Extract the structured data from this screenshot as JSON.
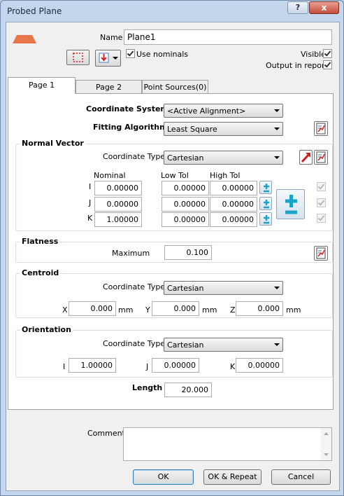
{
  "window": {
    "title": "Probed Plane",
    "help_label": "?",
    "close_label": "x"
  },
  "header": {
    "name_label": "Name",
    "name_value": "Plane1",
    "use_nominals_label": "Use nominals",
    "use_nominals_checked": true,
    "visible_label": "Visible",
    "visible_checked": true,
    "output_label": "Output in report",
    "output_checked": true
  },
  "tabs": [
    {
      "label": "Page 1",
      "active": true
    },
    {
      "label": "Page 2",
      "active": false
    },
    {
      "label": "Point Sources(0)",
      "active": false
    }
  ],
  "page1": {
    "coordinate_system_label": "Coordinate System",
    "coordinate_system_value": "<Active Alignment>",
    "fitting_algorithm_label": "Fitting Algorithm",
    "fitting_algorithm_value": "Least Square",
    "normal_vector": {
      "title": "Normal Vector",
      "coord_type_label": "Coordinate Type",
      "coord_type_value": "Cartesian",
      "col_nominal": "Nominal",
      "col_low_tol": "Low Tol",
      "col_high_tol": "High Tol",
      "rows": [
        {
          "axis": "I",
          "nominal": "0.00000",
          "low": "0.00000",
          "high": "0.00000",
          "checked": true
        },
        {
          "axis": "J",
          "nominal": "0.00000",
          "low": "0.00000",
          "high": "0.00000",
          "checked": true
        },
        {
          "axis": "K",
          "nominal": "1.00000",
          "low": "0.00000",
          "high": "0.00000",
          "checked": true
        }
      ]
    },
    "flatness": {
      "title": "Flatness",
      "maximum_label": "Maximum",
      "maximum_value": "0.100"
    },
    "centroid": {
      "title": "Centroid",
      "coord_type_label": "Coordinate Type",
      "coord_type_value": "Cartesian",
      "x_label": "X",
      "x_value": "0.000",
      "y_label": "Y",
      "y_value": "0.000",
      "z_label": "Z",
      "z_value": "0.000",
      "unit": "mm"
    },
    "orientation": {
      "title": "Orientation",
      "coord_type_label": "Coordinate Type",
      "coord_type_value": "Cartesian",
      "i_label": "I",
      "i_value": "1.00000",
      "j_label": "J",
      "j_value": "0.00000",
      "k_label": "K",
      "k_value": "0.00000"
    },
    "length_label": "Length",
    "length_value": "20.000"
  },
  "footer": {
    "comment_label": "Comment",
    "comment_value": "",
    "ok_label": "OK",
    "ok_repeat_label": "OK & Repeat",
    "cancel_label": "Cancel"
  },
  "colors": {
    "plane_icon": "#e8764a",
    "plus_icon": "#1aa3c9",
    "arrow_icon": "#d9342b"
  }
}
